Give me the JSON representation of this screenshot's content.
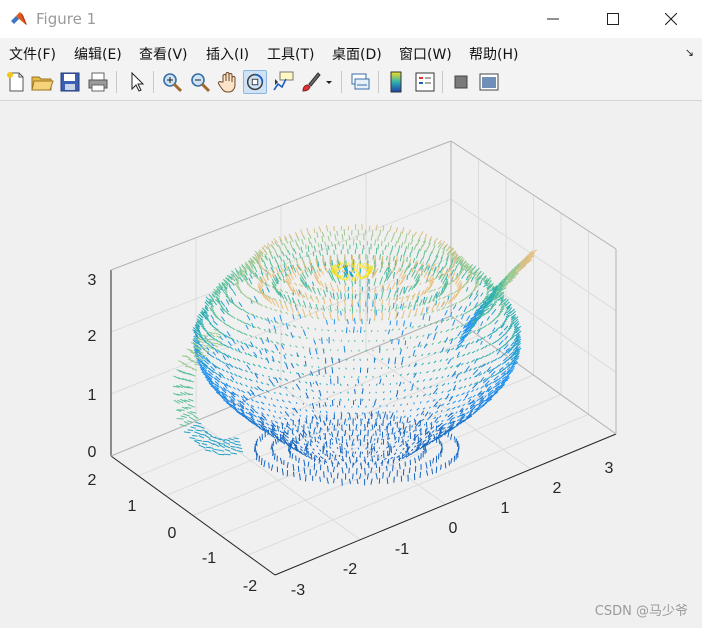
{
  "window": {
    "title": "Figure 1",
    "controls": {
      "minimize": "minimize",
      "maximize": "maximize",
      "close": "close"
    }
  },
  "menu": {
    "items": [
      "文件(F)",
      "编辑(E)",
      "查看(V)",
      "插入(I)",
      "工具(T)",
      "桌面(D)",
      "窗口(W)",
      "帮助(H)"
    ],
    "dock_glyph": "↘"
  },
  "toolbar": {
    "icons": [
      "new-figure-icon",
      "open-file-icon",
      "save-icon",
      "print-icon",
      "select-arrow-icon",
      "zoom-in-icon",
      "zoom-out-icon",
      "pan-hand-icon",
      "rotate-3d-icon",
      "data-cursor-icon",
      "brush-icon",
      "brush-dropdown-icon",
      "link-plot-icon",
      "colorbar-icon",
      "legend-icon",
      "hide-plot-tools-icon",
      "show-plot-tools-icon"
    ],
    "active_icon": "rotate-3d-icon"
  },
  "chart_data": {
    "type": "quiver3",
    "title": "",
    "xlabel": "",
    "ylabel": "",
    "zlabel": "",
    "x_ticks": [
      "-3",
      "-2",
      "-1",
      "0",
      "1",
      "2",
      "3"
    ],
    "y_ticks": [
      "-2",
      "-1",
      "0",
      "1",
      "2"
    ],
    "z_ticks": [
      "0",
      "1",
      "2",
      "3"
    ],
    "xlim": [
      -3,
      3.5
    ],
    "ylim": [
      -2,
      2
    ],
    "zlim": [
      0,
      3.2
    ],
    "grid": true,
    "colormap": [
      "#0d47a1",
      "#1e74d8",
      "#18a6c9",
      "#46b8a0",
      "#a8c98a",
      "#e6c080",
      "#f2e020"
    ],
    "surface": "teapot",
    "layer_colors": [
      "#1565c0",
      "#1976d2",
      "#1e88e5",
      "#2196f3",
      "#26a0c8",
      "#2fb0b0",
      "#5cbf98",
      "#9dc990",
      "#d8bf86",
      "#eac07e"
    ],
    "lid_knob_color": "#f2e020"
  },
  "watermark": "CSDN @马少爷"
}
